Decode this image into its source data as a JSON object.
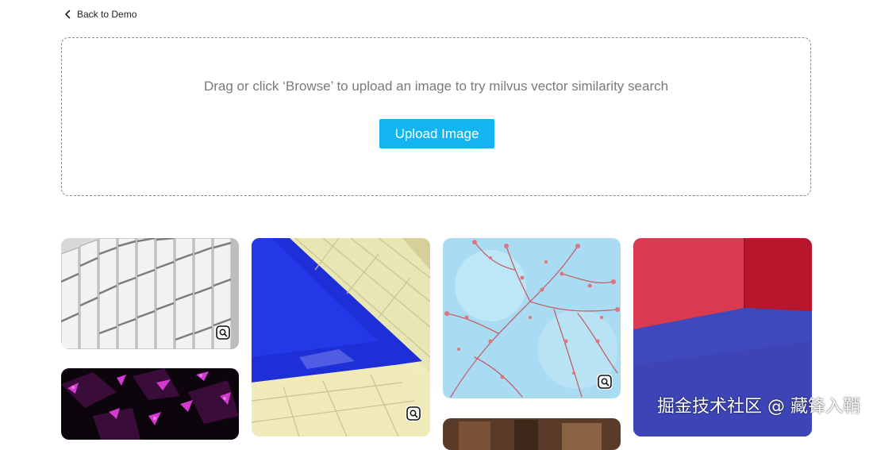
{
  "nav": {
    "back_label": "Back to Demo"
  },
  "upload": {
    "instruction": "Drag or click ‘Browse’ to upload an image to try milvus vector similarity search",
    "button_label": "Upload Image",
    "accent_color": "#12b5ef"
  },
  "gallery": {
    "images": [
      {
        "subject": "white architectural facade panels",
        "icon": "search-icon"
      },
      {
        "subject": "blue swimming pool edge with yellow tiles",
        "icon": "search-icon"
      },
      {
        "subject": "red blossom branches against light blue sky",
        "icon": "search-icon"
      },
      {
        "subject": "red walls with blue floor corner",
        "icon": "search-icon"
      },
      {
        "subject": "dark crumpled foil with magenta highlights",
        "icon": "search-icon"
      },
      {
        "subject": "brown wooden interior",
        "icon": "search-icon"
      }
    ]
  },
  "watermark": {
    "text": "掘金技术社区 @ 藏锋入鞘"
  }
}
